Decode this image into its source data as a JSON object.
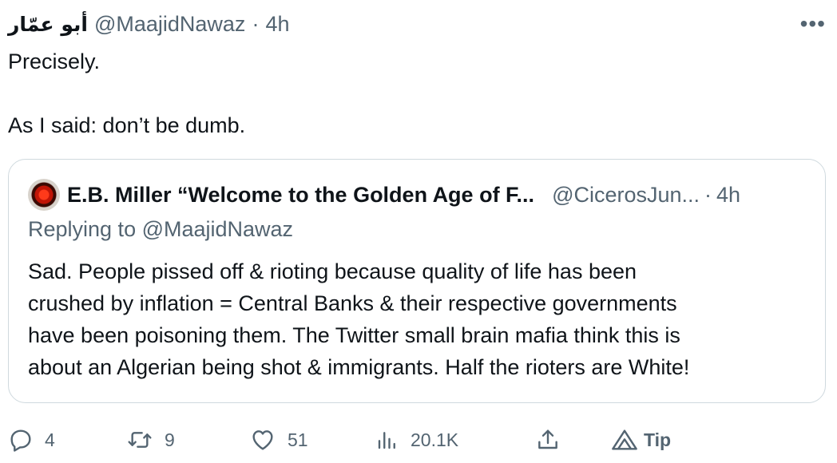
{
  "tweet": {
    "author_name": "أبو عمّار",
    "handle": "@MaajidNawaz",
    "separator": "·",
    "time": "4h",
    "more": "•••",
    "text_lines": [
      "Precisely.",
      "",
      "As I said: don’t be dumb."
    ]
  },
  "quote": {
    "author_name": "E.B. Miller “Welcome to the Golden Age of F...",
    "handle": "@CicerosJun...",
    "separator": "·",
    "time": "4h",
    "replying_to": "Replying to @MaajidNawaz",
    "text_lines": [
      "Sad. People pissed off & rioting because quality of life has been",
      "crushed by inflation = Central Banks & their respective governments",
      "have been poisoning them. The  Twitter small brain mafia think this is",
      "about an Algerian being shot & immigrants. Half the rioters are White!"
    ]
  },
  "actions": {
    "reply_icon": "reply-icon",
    "reply_count": "4",
    "retweet_icon": "retweet-icon",
    "retweet_count": "9",
    "like_icon": "heart-icon",
    "like_count": "51",
    "views_icon": "views-chart-icon",
    "views_count": "20.1K",
    "share_icon": "share-icon",
    "tip_icon": "tip-icon",
    "tip_label": "Tip"
  },
  "colors": {
    "text": "#0f1419",
    "secondary": "#536471",
    "border": "#cfd9de"
  }
}
